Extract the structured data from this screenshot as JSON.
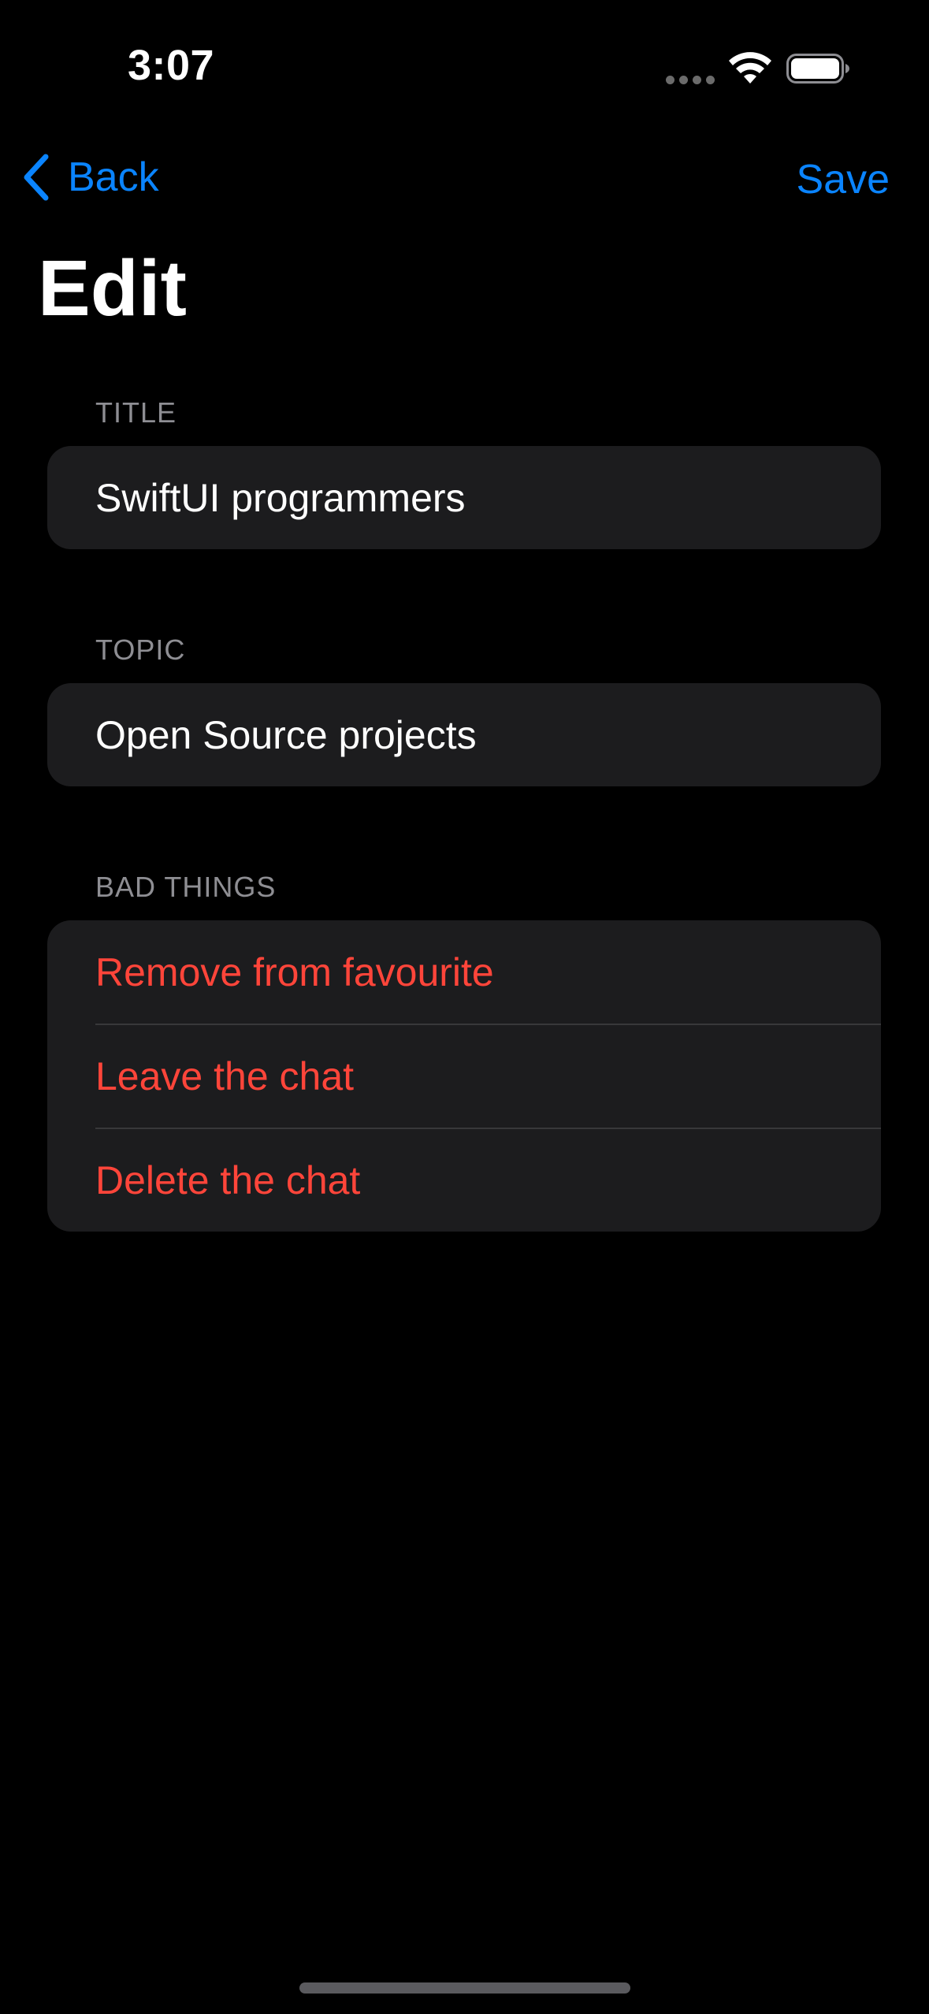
{
  "status_bar": {
    "time": "3:07",
    "icons": [
      "cellular-signal-icon",
      "wifi-icon",
      "battery-icon"
    ]
  },
  "nav": {
    "back_label": "Back",
    "save_label": "Save",
    "title": "Edit"
  },
  "sections": {
    "title": {
      "header": "TITLE",
      "value": "SwiftUI programmers"
    },
    "topic": {
      "header": "TOPIC",
      "value": "Open Source projects"
    },
    "bad_things": {
      "header": "BAD THINGS",
      "items": [
        {
          "label": "Remove from favourite"
        },
        {
          "label": "Leave the chat"
        },
        {
          "label": "Delete the chat"
        }
      ]
    }
  },
  "colors": {
    "accent": "#0a84ff",
    "destructive": "#ff453a",
    "background": "#000000",
    "card": "#1c1c1e",
    "secondary_text": "#8e8e93"
  }
}
